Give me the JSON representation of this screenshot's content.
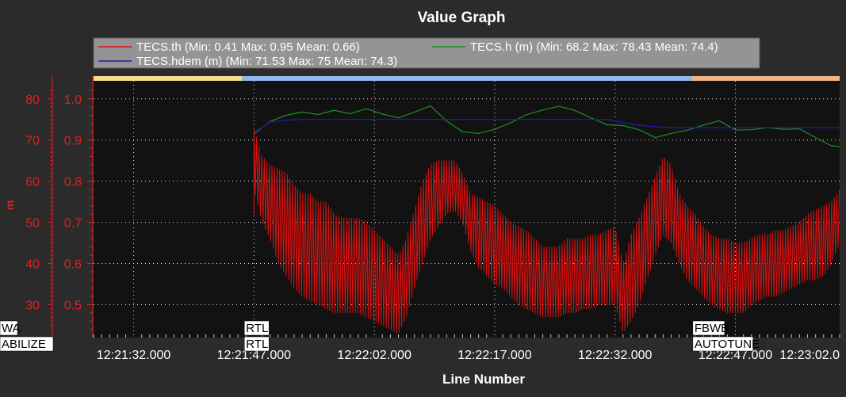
{
  "chart_data": {
    "type": "line",
    "title": "Value Graph",
    "xlabel": "Line Number",
    "ylabel_left": "m",
    "ylabel_right": "",
    "x_ticks": [
      "12:21:32.000",
      "12:21:47.000",
      "12:22:02.000",
      "12:22:17.000",
      "12:22:32.000",
      "12:22:47.000",
      "12:23:02.0"
    ],
    "x_range_seconds_from_first_tick": [
      -5,
      88
    ],
    "y_left_range": [
      22,
      84
    ],
    "y_left_ticks": [
      30,
      40,
      50,
      60,
      70,
      80
    ],
    "y_right_range": [
      0.42,
      1.04
    ],
    "y_right_ticks": [
      0.5,
      0.6,
      0.7,
      0.8,
      0.9,
      1.0
    ],
    "legend_placement": "top",
    "grid": true,
    "series": [
      {
        "name": "TECS.th (Min: 0.41 Max: 0.95 Mean: 0.66)",
        "axis": "right",
        "color": "#dd1111",
        "x": [
          15,
          16,
          17,
          18,
          19,
          20,
          21,
          22,
          23,
          24,
          25,
          26,
          27,
          28,
          29,
          30,
          31,
          32,
          33,
          34,
          35,
          36,
          37,
          38,
          39,
          40,
          41,
          42,
          43,
          44,
          45,
          46,
          47,
          48,
          49,
          50,
          51,
          52,
          53,
          54,
          55,
          56,
          57,
          58,
          59,
          60,
          61,
          62,
          63,
          64,
          65,
          66,
          67,
          68,
          69,
          70,
          71,
          72,
          73,
          74,
          75,
          76,
          77,
          78,
          79,
          80,
          81,
          82,
          83,
          84,
          85,
          86,
          87,
          88
        ],
        "upper": [
          0.93,
          0.86,
          0.84,
          0.83,
          0.82,
          0.79,
          0.77,
          0.77,
          0.75,
          0.75,
          0.72,
          0.71,
          0.71,
          0.71,
          0.7,
          0.68,
          0.66,
          0.64,
          0.62,
          0.66,
          0.73,
          0.8,
          0.84,
          0.85,
          0.85,
          0.85,
          0.82,
          0.77,
          0.76,
          0.75,
          0.74,
          0.72,
          0.7,
          0.69,
          0.68,
          0.66,
          0.64,
          0.64,
          0.64,
          0.66,
          0.66,
          0.66,
          0.67,
          0.67,
          0.68,
          0.69,
          0.6,
          0.67,
          0.71,
          0.76,
          0.81,
          0.86,
          0.84,
          0.77,
          0.74,
          0.72,
          0.69,
          0.67,
          0.66,
          0.66,
          0.65,
          0.65,
          0.66,
          0.67,
          0.67,
          0.68,
          0.68,
          0.69,
          0.7,
          0.72,
          0.73,
          0.74,
          0.75,
          0.78
        ],
        "lower": [
          0.78,
          0.7,
          0.66,
          0.6,
          0.57,
          0.54,
          0.52,
          0.51,
          0.5,
          0.49,
          0.48,
          0.48,
          0.48,
          0.48,
          0.47,
          0.46,
          0.45,
          0.44,
          0.43,
          0.47,
          0.54,
          0.6,
          0.66,
          0.69,
          0.72,
          0.73,
          0.7,
          0.63,
          0.59,
          0.57,
          0.55,
          0.54,
          0.52,
          0.5,
          0.49,
          0.48,
          0.47,
          0.47,
          0.47,
          0.48,
          0.48,
          0.49,
          0.49,
          0.5,
          0.5,
          0.5,
          0.43,
          0.46,
          0.5,
          0.56,
          0.62,
          0.67,
          0.65,
          0.6,
          0.56,
          0.54,
          0.52,
          0.5,
          0.49,
          0.48,
          0.48,
          0.48,
          0.5,
          0.51,
          0.52,
          0.52,
          0.53,
          0.54,
          0.55,
          0.56,
          0.56,
          0.57,
          0.6,
          0.65
        ]
      },
      {
        "name": "TECS.h (m) (Min: 68.2 Max: 78.43 Mean: 74.4)",
        "axis": "left",
        "color": "#1f8f1f",
        "x": [
          15,
          17,
          19,
          21,
          23,
          25,
          27,
          29,
          31,
          33,
          35,
          37,
          39,
          41,
          43,
          45,
          47,
          49,
          51,
          53,
          55,
          57,
          59,
          61,
          63,
          65,
          67,
          69,
          71,
          73,
          75,
          77,
          79,
          81,
          83,
          85,
          87,
          88
        ],
        "values": [
          71.5,
          74.5,
          76.0,
          76.8,
          76.2,
          77.2,
          76.4,
          77.6,
          76.3,
          75.4,
          76.8,
          78.3,
          74.6,
          72.0,
          71.6,
          72.6,
          74.2,
          76.2,
          77.3,
          78.2,
          77.2,
          75.4,
          73.7,
          73.5,
          72.5,
          70.6,
          71.6,
          72.4,
          73.6,
          74.7,
          72.4,
          72.5,
          73.0,
          72.6,
          72.7,
          70.6,
          68.6,
          68.4
        ]
      },
      {
        "name": "TECS.hdem (m) (Min: 71.53 Max: 75 Mean: 74.3)",
        "axis": "left",
        "color": "#1c1ca8",
        "x": [
          15,
          17,
          19,
          21,
          23,
          25,
          27,
          29,
          31,
          33,
          35,
          37,
          39,
          41,
          43,
          45,
          47,
          49,
          51,
          53,
          55,
          57,
          59,
          61,
          63,
          65,
          67,
          69,
          71,
          73,
          75,
          77,
          79,
          81,
          83,
          85,
          87,
          88
        ],
        "values": [
          71.8,
          74.4,
          74.8,
          75.0,
          75.0,
          75.0,
          75.0,
          75.0,
          75.0,
          75.0,
          75.0,
          75.0,
          75.0,
          75.0,
          75.0,
          75.0,
          75.0,
          75.0,
          75.0,
          75.0,
          75.0,
          75.0,
          75.0,
          74.2,
          73.6,
          73.2,
          73.0,
          73.0,
          73.0,
          73.0,
          73.0,
          73.0,
          73.0,
          73.0,
          73.0,
          73.0,
          73.0,
          73.0
        ]
      }
    ],
    "mode_bands": [
      {
        "from": -5,
        "to": 13.5,
        "color": "#f5e08a"
      },
      {
        "from": 13.5,
        "to": 69.5,
        "color": "#8fb8ef"
      },
      {
        "from": 69.5,
        "to": 88,
        "color": "#f2b486"
      }
    ],
    "mode_labels": [
      {
        "x": -5,
        "row": 1,
        "text": "WA"
      },
      {
        "x": -5,
        "row": 2,
        "text": "ABILIZE"
      },
      {
        "x": 13.8,
        "row": 1,
        "text": "RTL"
      },
      {
        "x": 13.8,
        "row": 2,
        "text": "RTL"
      },
      {
        "x": 69.7,
        "row": 1,
        "text": "FBWB"
      },
      {
        "x": 69.7,
        "row": 2,
        "text": "AUTOTUNE"
      }
    ]
  }
}
